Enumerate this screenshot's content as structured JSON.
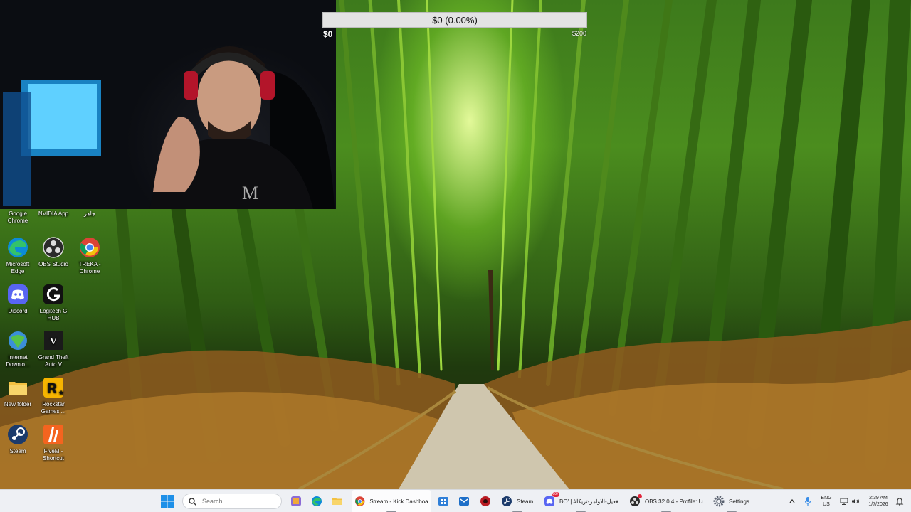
{
  "overlay": {
    "goal_text": "$0 (0.00%)",
    "goal_min": "$0",
    "goal_max": "$200",
    "goal_progress_percent": 0
  },
  "desktop_icons": [
    {
      "label": "Google Chrome",
      "icon": "chrome-icon"
    },
    {
      "label": "NVIDIA App",
      "icon": "nvidia-icon"
    },
    {
      "label": "جاهز",
      "icon": "file-icon"
    },
    {
      "label": "Microsoft Edge",
      "icon": "edge-icon"
    },
    {
      "label": "OBS Studio",
      "icon": "obs-icon"
    },
    {
      "label": "TREKA - Chrome",
      "icon": "chrome-icon"
    },
    {
      "label": "Discord",
      "icon": "discord-icon"
    },
    {
      "label": "Logitech G HUB",
      "icon": "logitech-icon"
    },
    {
      "label": "Internet Downlo...",
      "icon": "idm-icon"
    },
    {
      "label": "Grand Theft Auto V",
      "icon": "gta-icon"
    },
    {
      "label": "New folder",
      "icon": "folder-icon"
    },
    {
      "label": "Rockstar Games ...",
      "icon": "rockstar-icon"
    },
    {
      "label": "Steam",
      "icon": "steam-icon"
    },
    {
      "label": "FiveM - Shortcut",
      "icon": "fivem-icon"
    }
  ],
  "taskbar": {
    "search_placeholder": "Search",
    "apps": [
      {
        "label": "Stream - Kick Dashboard",
        "icon": "chrome-icon"
      },
      {
        "label": "Steam",
        "icon": "steam-icon"
      },
      {
        "label": "BO' | #تفعيل-الاوامر-تريكا",
        "icon": "discord-icon",
        "badge": "99+"
      },
      {
        "label": "OBS 32.0.4 - Profile: Unt",
        "icon": "obs-icon"
      },
      {
        "label": "Settings",
        "icon": "gear-icon"
      }
    ],
    "tray": {
      "language": "ENG",
      "region": "US",
      "time": "2:39 AM",
      "date": "1/7/2026"
    }
  },
  "colors": {
    "taskbar_bg": "#eef0f4",
    "goal_bar_bg": "#e3e3e3",
    "chrome_red": "#db4437",
    "discord_blurple": "#5865f2"
  }
}
